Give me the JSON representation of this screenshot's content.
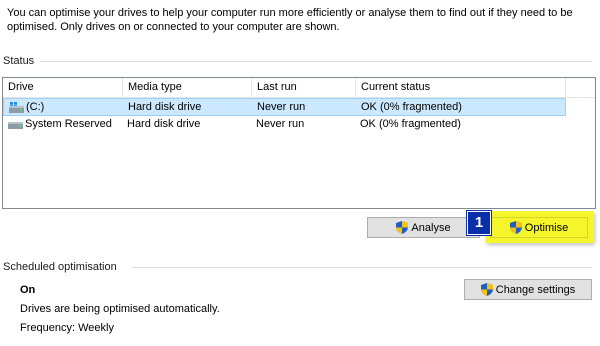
{
  "intro": {
    "text": "You can optimise your drives to help your computer run more efficiently or analyse them to find out if they need to be optimised. Only drives on or connected to your computer are shown."
  },
  "status": {
    "label": "Status"
  },
  "table": {
    "columns": [
      "Drive",
      "Media type",
      "Last run",
      "Current status"
    ],
    "rows": [
      {
        "drive": "(C:)",
        "media": "Hard disk drive",
        "last_run": "Never run",
        "status": "OK (0% fragmented)",
        "icon": "windows-drive-icon"
      },
      {
        "drive": "System Reserved",
        "media": "Hard disk drive",
        "last_run": "Never run",
        "status": "OK (0% fragmented)",
        "icon": "drive-icon"
      }
    ],
    "selected_row": 0
  },
  "buttons": {
    "analyse": "Analyse",
    "optimise": "Optimise",
    "change_settings": "Change settings"
  },
  "badge": {
    "number": "1"
  },
  "scheduled": {
    "label": "Scheduled optimisation",
    "state": "On",
    "description": "Drives are being optimised automatically.",
    "frequency": "Frequency: Weekly"
  },
  "colors": {
    "selection": "#cce8ff",
    "highlight": "#f5f52c",
    "badge": "#0a2ea8"
  }
}
